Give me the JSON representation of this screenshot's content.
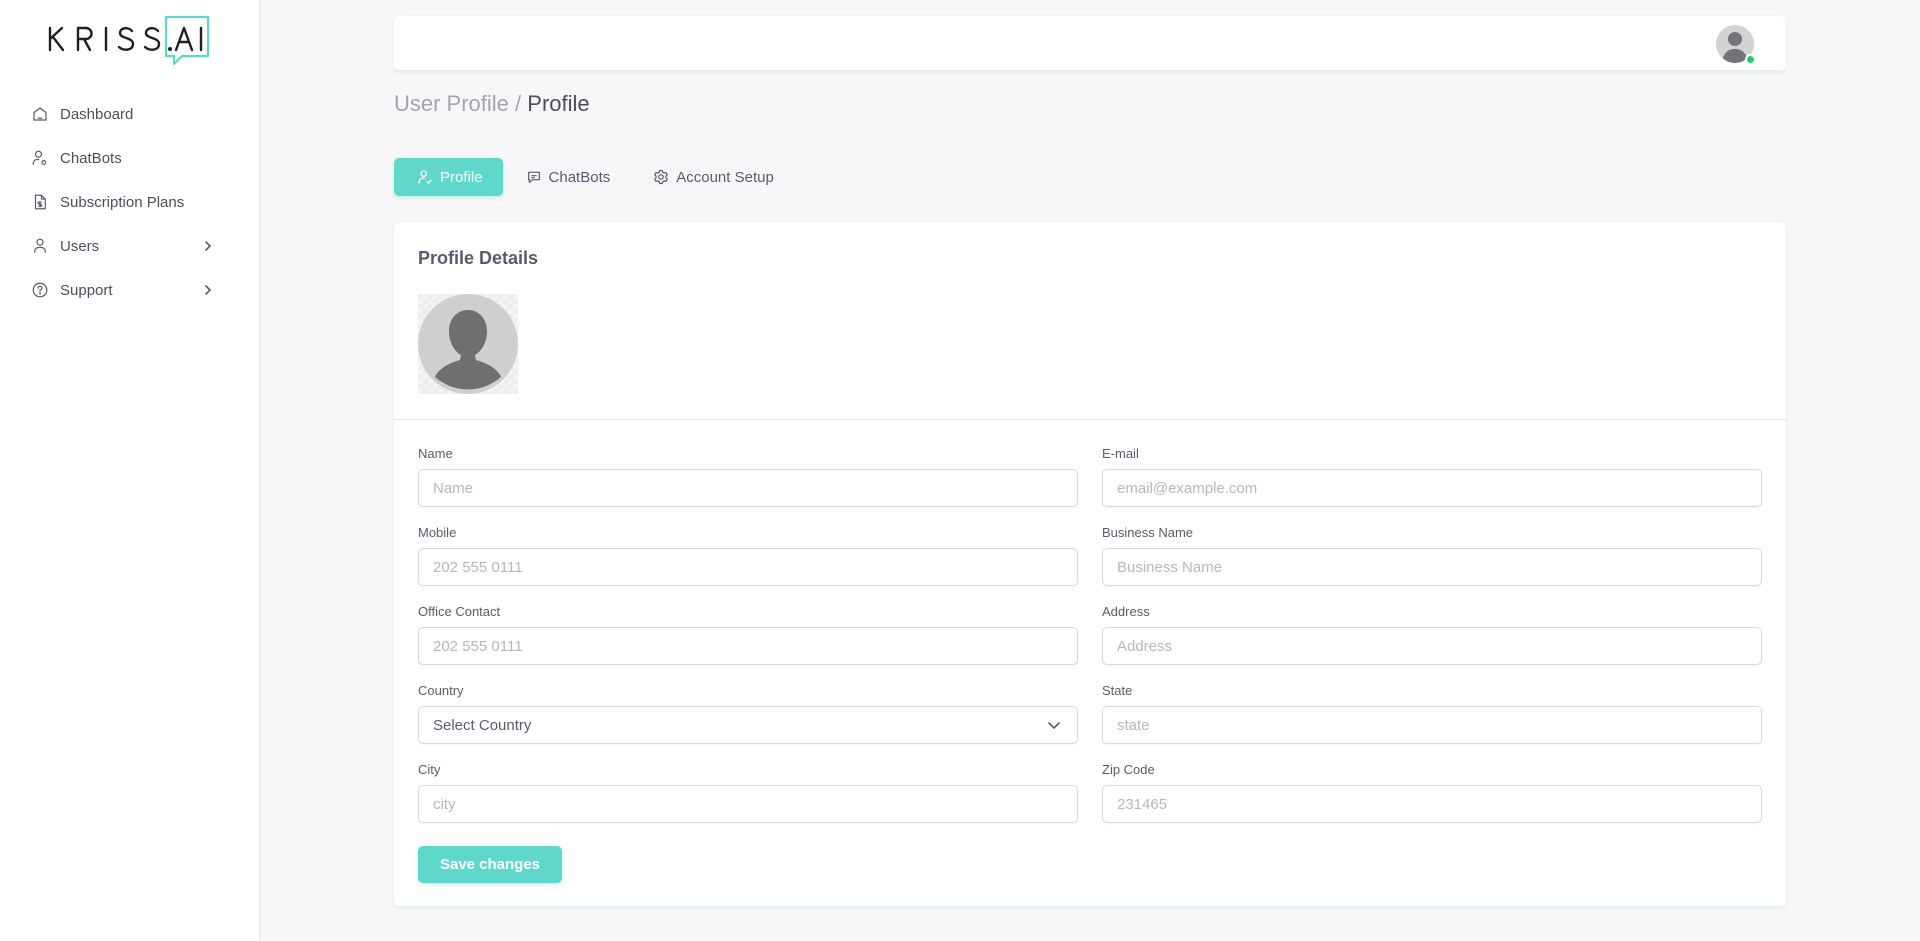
{
  "app": {
    "logo_text": "KRISS.AI",
    "accent_color": "#5fd8cb"
  },
  "sidebar": {
    "items": [
      {
        "label": "Dashboard",
        "icon": "home-icon",
        "has_submenu": false
      },
      {
        "label": "ChatBots",
        "icon": "user-cog-icon",
        "has_submenu": false
      },
      {
        "label": "Subscription Plans",
        "icon": "invoice-dollar-icon",
        "has_submenu": false
      },
      {
        "label": "Users",
        "icon": "user-icon",
        "has_submenu": true
      },
      {
        "label": "Support",
        "icon": "help-circle-icon",
        "has_submenu": true
      }
    ]
  },
  "header": {
    "avatar_icon": "user-avatar-icon",
    "status": "online",
    "status_color": "#28c76f"
  },
  "breadcrumb": {
    "parent": "User Profile /",
    "current": "Profile"
  },
  "tabs": [
    {
      "label": "Profile",
      "icon": "user-check-icon",
      "active": true
    },
    {
      "label": "ChatBots",
      "icon": "message-icon",
      "active": false
    },
    {
      "label": "Account Setup",
      "icon": "settings-icon",
      "active": false
    }
  ],
  "profile": {
    "title": "Profile Details",
    "avatar_icon": "default-avatar-icon"
  },
  "form": {
    "name": {
      "label": "Name",
      "placeholder": "Name",
      "value": ""
    },
    "email": {
      "label": "E-mail",
      "placeholder": "email@example.com",
      "value": ""
    },
    "mobile": {
      "label": "Mobile",
      "placeholder": "202 555 0111",
      "value": ""
    },
    "business_name": {
      "label": "Business Name",
      "placeholder": "Business Name",
      "value": ""
    },
    "office_contact": {
      "label": "Office Contact",
      "placeholder": "202 555 0111",
      "value": ""
    },
    "address": {
      "label": "Address",
      "placeholder": "Address",
      "value": ""
    },
    "country": {
      "label": "Country",
      "selected": "Select Country"
    },
    "state": {
      "label": "State",
      "placeholder": "state",
      "value": ""
    },
    "city": {
      "label": "City",
      "placeholder": "city",
      "value": ""
    },
    "zip_code": {
      "label": "Zip Code",
      "placeholder": "231465",
      "value": ""
    },
    "save_label": "Save changes"
  }
}
